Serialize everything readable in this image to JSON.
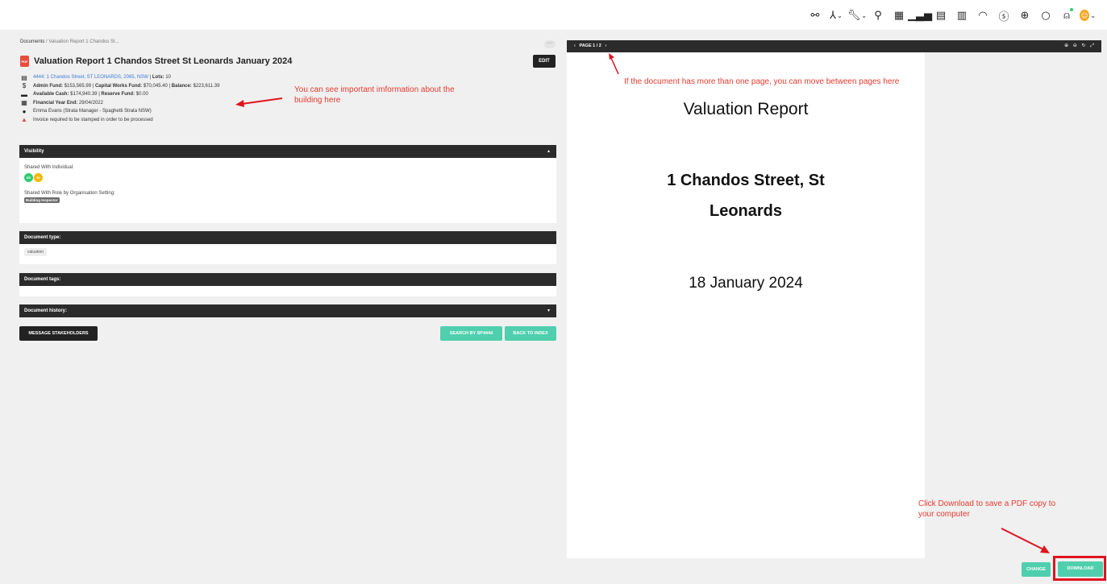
{
  "topbar": {
    "icons": [
      "network-icon",
      "org-chart-icon",
      "wrench-icon",
      "award-icon",
      "calendar-check-icon",
      "bar-chart-icon",
      "document-icon",
      "building-icon",
      "gauge-icon",
      "dollar-icon",
      "lifebuoy-icon",
      "chat-icon",
      "bell-icon",
      "user-avatar"
    ]
  },
  "breadcrumb": {
    "root": "Documents",
    "sep": " / ",
    "current": "Valuation Report 1 Chandos St..."
  },
  "more_label": "···",
  "document": {
    "file_badge": "PDF",
    "title": "Valuation Report 1 Chandos Street St Leonards January 2024",
    "edit_label": "EDIT"
  },
  "info": {
    "building_link": "4444: 1 Chandos Street, ST LEONARDS, 2065, NSW",
    "lots_label": "Lots:",
    "lots_value": "10",
    "admin_fund_label": "Admin Fund:",
    "admin_fund_value": "$153,565.99",
    "capital_works_label": "Capital Works Fund:",
    "capital_works_value": "$70,045.40",
    "balance_label": "Balance:",
    "balance_value": "$223,611.39",
    "available_cash_label": "Available Cash:",
    "available_cash_value": "$174,940.39",
    "reserve_fund_label": "Reserve Fund:",
    "reserve_fund_value": "$0.00",
    "fy_end_label": "Financial Year End:",
    "fy_end_value": "29/04/2022",
    "manager": "Emma Evans (Strata Manager - Spaghetti Strata NSW)",
    "stamp_note": "Invoice required to be stamped in order to be processed",
    "separator": "|"
  },
  "visibility": {
    "heading": "Visibility",
    "shared_individual_label": "Shared With Individual:",
    "avatars": [
      {
        "initials": "EE",
        "color": "#2ecc71"
      },
      {
        "initials": "BI",
        "color": "#f5b800"
      }
    ],
    "shared_role_label": "Shared With Role by Organisation Setting:",
    "role_tag": "Building Inspector"
  },
  "doc_type": {
    "heading": "Document type:",
    "value": "valuation"
  },
  "doc_tags": {
    "heading": "Document tags:"
  },
  "doc_history": {
    "heading": "Document history:"
  },
  "buttons": {
    "message": "MESSAGE STAKEHOLDERS",
    "search": "SEARCH BY SP4444",
    "back": "BACK TO INDEX",
    "change": "CHANGE",
    "download": "DOWNLOAD"
  },
  "viewer": {
    "page_indicator": "PAGE 1 / 2",
    "prev": "‹",
    "next": "›",
    "tools": "⊕ ⊖ ↻ ⤢",
    "page_title": "Valuation Report",
    "address_line1": "1 Chandos Street, St",
    "address_line2": "Leonards",
    "date": "18 January 2024"
  },
  "annotations": {
    "info_note_line1": "You can see important imformation about the",
    "info_note_line2": "building here",
    "page_note": "If the document has more than one page, you can move between pages here",
    "download_note_line1": "Click Download to save a PDF copy to",
    "download_note_line2": "your computer"
  },
  "colors": {
    "accent_teal": "#4fcfad",
    "dark": "#2b2b2b",
    "annotation_red": "#e63b2e",
    "link_blue": "#3b7bd6"
  }
}
